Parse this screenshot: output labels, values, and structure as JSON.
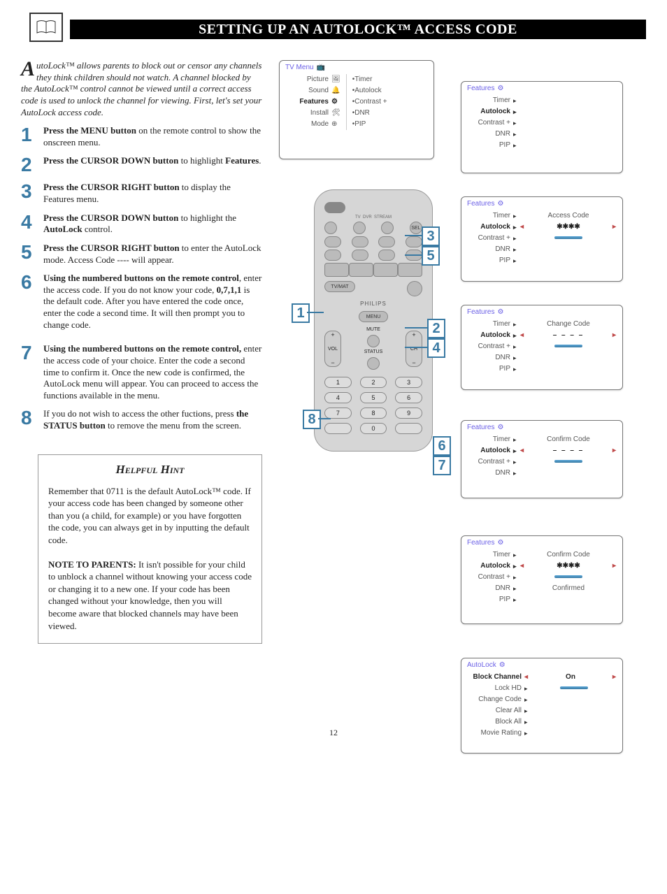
{
  "page_number": "12",
  "title_html": "S<span>ETTING</span> U<span>P</span> <span>AN</span> A<span>UTO</span>L<span>OCK</span>™ A<span>CCESS</span> C<span>ODE</span>",
  "intro": {
    "dropcap": "A",
    "text": "utoLock™ allows parents to block out or censor any channels they think children should not watch. A channel blocked by the AutoLock™ control cannot be viewed until a correct access code is used to unlock the channel for viewing. First, let's set your AutoLock access code."
  },
  "steps": [
    {
      "n": "1",
      "body_html": "<b>Press the MENU button</b> on the remote control to show the onscreen menu."
    },
    {
      "n": "2",
      "body_html": "<b>Press the CURSOR DOWN button</b> to highlight <b>Features</b>."
    },
    {
      "n": "3",
      "body_html": "<b>Press the CURSOR RIGHT button</b> to display the Features menu."
    },
    {
      "n": "4",
      "body_html": "<b>Press the CURSOR DOWN button</b> to highlight the <b>AutoLock</b> control."
    },
    {
      "n": "5",
      "body_html": "<b>Press the CURSOR RIGHT button</b> to enter the AutoLock mode. Access Code ---- will appear."
    },
    {
      "n": "6",
      "body_html": "<b>Using the numbered buttons on the remote control</b>, enter the access code. If you do not know your code, <b>0,7,1,1</b> is the default code. After you have entered the code once, enter the code a second time. It will then prompt you to change code."
    },
    {
      "n": "7",
      "body_html": "<b>Using the numbered buttons on the remote control,</b> enter the access code of your choice. Enter the code a second time to confirm it. Once the new code is confirmed, the AutoLock menu will appear. You can proceed to access the functions available in the menu."
    },
    {
      "n": "8",
      "body_html": "If you do not wish to access the other fuctions, press <b>the STATUS button</b> to remove the menu from the screen."
    }
  ],
  "hint": {
    "title": "Helpful Hint",
    "p1": "Remember that 0711 is the default AutoLock™ code. If your access code has been changed by someone other than you (a child, for example) or you have forgotten the code, you can always get in by inputting the default code.",
    "p2_label": "NOTE TO PARENTS:",
    "p2_body": " It isn't possible for your child to unblock a channel without knowing your access code or changing it to a new one. If your code has been changed without your knowledge, then you will become aware that blocked channels may have been viewed."
  },
  "osd": {
    "tvmenu": {
      "title": "TV Menu",
      "left": [
        "Picture",
        "Sound",
        "Features",
        "Install",
        "Mode"
      ],
      "right": [
        "Timer",
        "Autolock",
        "Contrast +",
        "DNR",
        "PIP"
      ]
    },
    "features_items": [
      "Timer",
      "Autolock",
      "Contrast +",
      "DNR",
      "PIP"
    ],
    "panel2": {
      "title": "Features",
      "active": "Autolock"
    },
    "panel3": {
      "title": "Features",
      "active": "Autolock",
      "extra_label": "Access Code",
      "extra_value": "✱✱✱✱"
    },
    "panel4": {
      "title": "Features",
      "active": "Autolock",
      "extra_label": "Change Code",
      "extra_value": "– – – –"
    },
    "panel5": {
      "title": "Features",
      "active": "Autolock",
      "extra_label": "Confirm Code",
      "extra_value": "– – – –"
    },
    "panel6": {
      "title": "Features",
      "active": "Autolock",
      "extra_label": "Confirm Code",
      "extra_value": "✱✱✱✱",
      "confirmed": "Confirmed"
    },
    "autolock": {
      "title": "AutoLock",
      "items": [
        "Block Channel",
        "Lock HD",
        "Change Code",
        "Clear All",
        "Block All",
        "Movie Rating"
      ],
      "active": "Block Channel",
      "value": "On"
    }
  },
  "remote": {
    "brand": "PHILIPS",
    "labels": {
      "menu": "MENU",
      "vol": "VOL",
      "ch": "CH",
      "mute": "MUTE",
      "status": "STATUS"
    },
    "keys": [
      "1",
      "2",
      "3",
      "4",
      "5",
      "6",
      "7",
      "8",
      "9",
      "",
      "0",
      ""
    ]
  },
  "callouts": [
    "1",
    "2",
    "3",
    "4",
    "5",
    "6",
    "7",
    "8"
  ]
}
